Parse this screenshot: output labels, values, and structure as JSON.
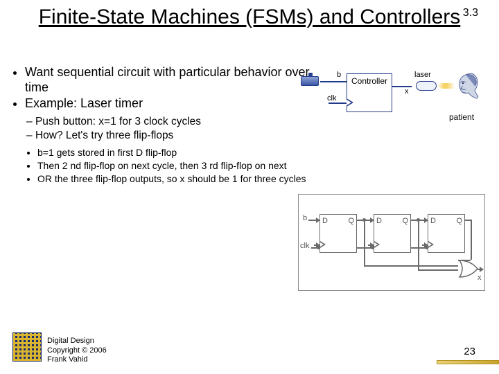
{
  "title": "Finite-State Machines (FSMs) and Controllers",
  "section_number": "3.3",
  "bullets": {
    "b1": "Want sequential circuit with particular behavior over time",
    "b2": "Example: Laser timer",
    "s1": "Push button: x=1 for 3 clock cycles",
    "s2": "How? Let's try three flip-flops",
    "t1": "b=1 gets stored in first D flip-flop",
    "t2": "Then 2 nd flip-flop on next cycle, then 3 rd flip-flop on next",
    "t3": "OR the three flip-flop outputs, so x should be 1 for three cycles"
  },
  "diagram_top": {
    "b": "b",
    "clk": "clk",
    "controller": "Controller",
    "x": "x",
    "laser": "laser",
    "patient": "patient"
  },
  "diagram_bot": {
    "b": "b",
    "clk": "clk",
    "D": "D",
    "Q": "Q",
    "x": "x"
  },
  "footer": {
    "line1": "Digital Design",
    "line2": "Copyright © 2006",
    "line3": "Frank Vahid"
  },
  "page_number": "23"
}
